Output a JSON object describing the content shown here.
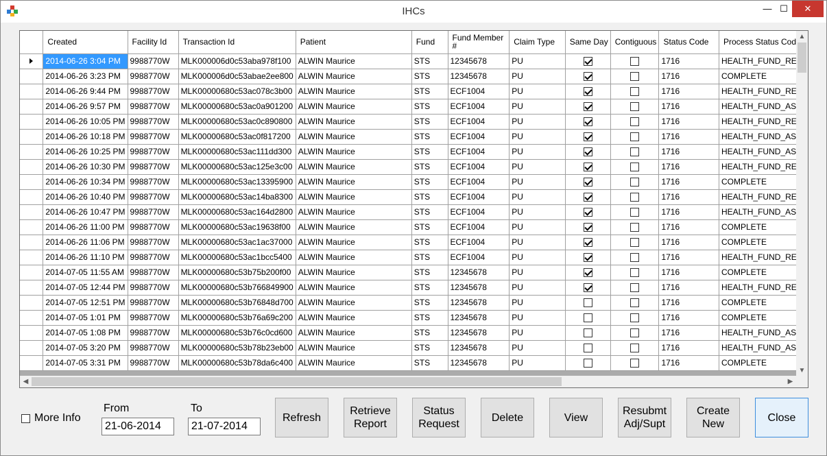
{
  "window": {
    "title": "IHCs",
    "minimize": "—",
    "maximize": "☐",
    "close": "✕"
  },
  "columns": [
    "Created",
    "Facility Id",
    "Transaction Id",
    "Patient",
    "Fund",
    "Fund Member #",
    "Claim Type",
    "Same Day",
    "Contiguous",
    "Status Code",
    "Process Status Code"
  ],
  "rows": [
    {
      "created": "2014-06-26 3:04 PM",
      "facility": "9988770W",
      "txn": "MLK000006d0c53aba978f100",
      "patient": "ALWIN Maurice",
      "fund": "STS",
      "member": "12345678",
      "claim": "PU",
      "same_day": true,
      "contiguous": false,
      "status": "1716",
      "process": "HEALTH_FUND_REJ"
    },
    {
      "created": "2014-06-26 3:23 PM",
      "facility": "9988770W",
      "txn": "MLK000006d0c53abae2ee800",
      "patient": "ALWIN Maurice",
      "fund": "STS",
      "member": "12345678",
      "claim": "PU",
      "same_day": true,
      "contiguous": false,
      "status": "1716",
      "process": "COMPLETE"
    },
    {
      "created": "2014-06-26 9:44 PM",
      "facility": "9988770W",
      "txn": "MLK00000680c53ac078c3b00",
      "patient": "ALWIN Maurice",
      "fund": "STS",
      "member": "ECF1004",
      "claim": "PU",
      "same_day": true,
      "contiguous": false,
      "status": "1716",
      "process": "HEALTH_FUND_REJ"
    },
    {
      "created": "2014-06-26 9:57 PM",
      "facility": "9988770W",
      "txn": "MLK00000680c53ac0a901200",
      "patient": "ALWIN Maurice",
      "fund": "STS",
      "member": "ECF1004",
      "claim": "PU",
      "same_day": true,
      "contiguous": false,
      "status": "1716",
      "process": "HEALTH_FUND_ASS"
    },
    {
      "created": "2014-06-26 10:05 PM",
      "facility": "9988770W",
      "txn": "MLK00000680c53ac0c890800",
      "patient": "ALWIN Maurice",
      "fund": "STS",
      "member": "ECF1004",
      "claim": "PU",
      "same_day": true,
      "contiguous": false,
      "status": "1716",
      "process": "HEALTH_FUND_REJ"
    },
    {
      "created": "2014-06-26 10:18 PM",
      "facility": "9988770W",
      "txn": "MLK00000680c53ac0f817200",
      "patient": "ALWIN Maurice",
      "fund": "STS",
      "member": "ECF1004",
      "claim": "PU",
      "same_day": true,
      "contiguous": false,
      "status": "1716",
      "process": "HEALTH_FUND_ASS"
    },
    {
      "created": "2014-06-26 10:25 PM",
      "facility": "9988770W",
      "txn": "MLK00000680c53ac111dd300",
      "patient": "ALWIN Maurice",
      "fund": "STS",
      "member": "ECF1004",
      "claim": "PU",
      "same_day": true,
      "contiguous": false,
      "status": "1716",
      "process": "HEALTH_FUND_ASS"
    },
    {
      "created": "2014-06-26 10:30 PM",
      "facility": "9988770W",
      "txn": "MLK00000680c53ac125e3c00",
      "patient": "ALWIN Maurice",
      "fund": "STS",
      "member": "ECF1004",
      "claim": "PU",
      "same_day": true,
      "contiguous": false,
      "status": "1716",
      "process": "HEALTH_FUND_REJ"
    },
    {
      "created": "2014-06-26 10:34 PM",
      "facility": "9988770W",
      "txn": "MLK00000680c53ac13395900",
      "patient": "ALWIN Maurice",
      "fund": "STS",
      "member": "ECF1004",
      "claim": "PU",
      "same_day": true,
      "contiguous": false,
      "status": "1716",
      "process": "COMPLETE"
    },
    {
      "created": "2014-06-26 10:40 PM",
      "facility": "9988770W",
      "txn": "MLK00000680c53ac14ba8300",
      "patient": "ALWIN Maurice",
      "fund": "STS",
      "member": "ECF1004",
      "claim": "PU",
      "same_day": true,
      "contiguous": false,
      "status": "1716",
      "process": "HEALTH_FUND_REJ"
    },
    {
      "created": "2014-06-26 10:47 PM",
      "facility": "9988770W",
      "txn": "MLK00000680c53ac164d2800",
      "patient": "ALWIN Maurice",
      "fund": "STS",
      "member": "ECF1004",
      "claim": "PU",
      "same_day": true,
      "contiguous": false,
      "status": "1716",
      "process": "HEALTH_FUND_ASS"
    },
    {
      "created": "2014-06-26 11:00 PM",
      "facility": "9988770W",
      "txn": "MLK00000680c53ac19638f00",
      "patient": "ALWIN Maurice",
      "fund": "STS",
      "member": "ECF1004",
      "claim": "PU",
      "same_day": true,
      "contiguous": false,
      "status": "1716",
      "process": "COMPLETE"
    },
    {
      "created": "2014-06-26 11:06 PM",
      "facility": "9988770W",
      "txn": "MLK00000680c53ac1ac37000",
      "patient": "ALWIN Maurice",
      "fund": "STS",
      "member": "ECF1004",
      "claim": "PU",
      "same_day": true,
      "contiguous": false,
      "status": "1716",
      "process": "COMPLETE"
    },
    {
      "created": "2014-06-26 11:10 PM",
      "facility": "9988770W",
      "txn": "MLK00000680c53ac1bcc5400",
      "patient": "ALWIN Maurice",
      "fund": "STS",
      "member": "ECF1004",
      "claim": "PU",
      "same_day": true,
      "contiguous": false,
      "status": "1716",
      "process": "HEALTH_FUND_REJ"
    },
    {
      "created": "2014-07-05 11:55 AM",
      "facility": "9988770W",
      "txn": "MLK00000680c53b75b200f00",
      "patient": "ALWIN Maurice",
      "fund": "STS",
      "member": "12345678",
      "claim": "PU",
      "same_day": true,
      "contiguous": false,
      "status": "1716",
      "process": "COMPLETE"
    },
    {
      "created": "2014-07-05 12:44 PM",
      "facility": "9988770W",
      "txn": "MLK00000680c53b766849900",
      "patient": "ALWIN Maurice",
      "fund": "STS",
      "member": "12345678",
      "claim": "PU",
      "same_day": true,
      "contiguous": false,
      "status": "1716",
      "process": "HEALTH_FUND_REJ"
    },
    {
      "created": "2014-07-05 12:51 PM",
      "facility": "9988770W",
      "txn": "MLK00000680c53b76848d700",
      "patient": "ALWIN Maurice",
      "fund": "STS",
      "member": "12345678",
      "claim": "PU",
      "same_day": false,
      "contiguous": false,
      "status": "1716",
      "process": "COMPLETE"
    },
    {
      "created": "2014-07-05 1:01 PM",
      "facility": "9988770W",
      "txn": "MLK00000680c53b76a69c200",
      "patient": "ALWIN Maurice",
      "fund": "STS",
      "member": "12345678",
      "claim": "PU",
      "same_day": false,
      "contiguous": false,
      "status": "1716",
      "process": "COMPLETE"
    },
    {
      "created": "2014-07-05 1:08 PM",
      "facility": "9988770W",
      "txn": "MLK00000680c53b76c0cd600",
      "patient": "ALWIN Maurice",
      "fund": "STS",
      "member": "12345678",
      "claim": "PU",
      "same_day": false,
      "contiguous": false,
      "status": "1716",
      "process": "HEALTH_FUND_ASS"
    },
    {
      "created": "2014-07-05 3:20 PM",
      "facility": "9988770W",
      "txn": "MLK00000680c53b78b23eb00",
      "patient": "ALWIN Maurice",
      "fund": "STS",
      "member": "12345678",
      "claim": "PU",
      "same_day": false,
      "contiguous": false,
      "status": "1716",
      "process": "HEALTH_FUND_ASS"
    },
    {
      "created": "2014-07-05 3:31 PM",
      "facility": "9988770W",
      "txn": "MLK00000680c53b78da6c400",
      "patient": "ALWIN Maurice",
      "fund": "STS",
      "member": "12345678",
      "claim": "PU",
      "same_day": false,
      "contiguous": false,
      "status": "1716",
      "process": "COMPLETE"
    }
  ],
  "filters": {
    "more_info_label": "More Info",
    "from_label": "From",
    "from_value": "21-06-2014",
    "to_label": "To",
    "to_value": "21-07-2014"
  },
  "buttons": {
    "refresh": "Refresh",
    "retrieve_report": "Retrieve\nReport",
    "status_request": "Status\nRequest",
    "delete": "Delete",
    "view": "View",
    "resubmit": "Resubmt\nAdj/Supt",
    "create_new": "Create\nNew",
    "close": "Close"
  }
}
